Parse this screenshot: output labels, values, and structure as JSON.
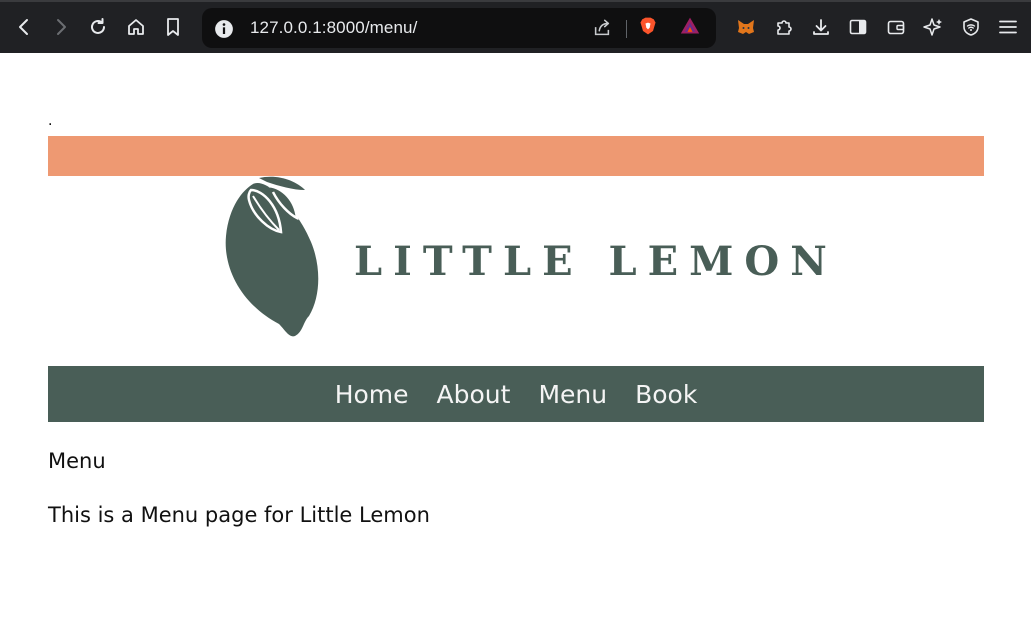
{
  "browser": {
    "url": "127.0.0.1:8000/menu/"
  },
  "page": {
    "stray_text": ".",
    "logo_text": "LITTLE LEMON",
    "nav": [
      {
        "label": "Home"
      },
      {
        "label": "About"
      },
      {
        "label": "Menu"
      },
      {
        "label": "Book"
      }
    ],
    "heading": "Menu",
    "description": "This is a Menu page for Little Lemon"
  },
  "colors": {
    "band": "#ee9972",
    "brand_green": "#495e57",
    "chrome_bg": "#202124"
  },
  "icons": [
    "back-icon",
    "forward-icon",
    "reload-icon",
    "home-icon",
    "bookmark-icon",
    "info-icon",
    "share-icon",
    "brave-shield-icon",
    "bat-rewards-icon",
    "metamask-icon",
    "extensions-icon",
    "download-icon",
    "sidebar-icon",
    "wallet-icon",
    "leo-ai-icon",
    "vpn-icon",
    "menu-icon",
    "lemon-logo-icon"
  ]
}
